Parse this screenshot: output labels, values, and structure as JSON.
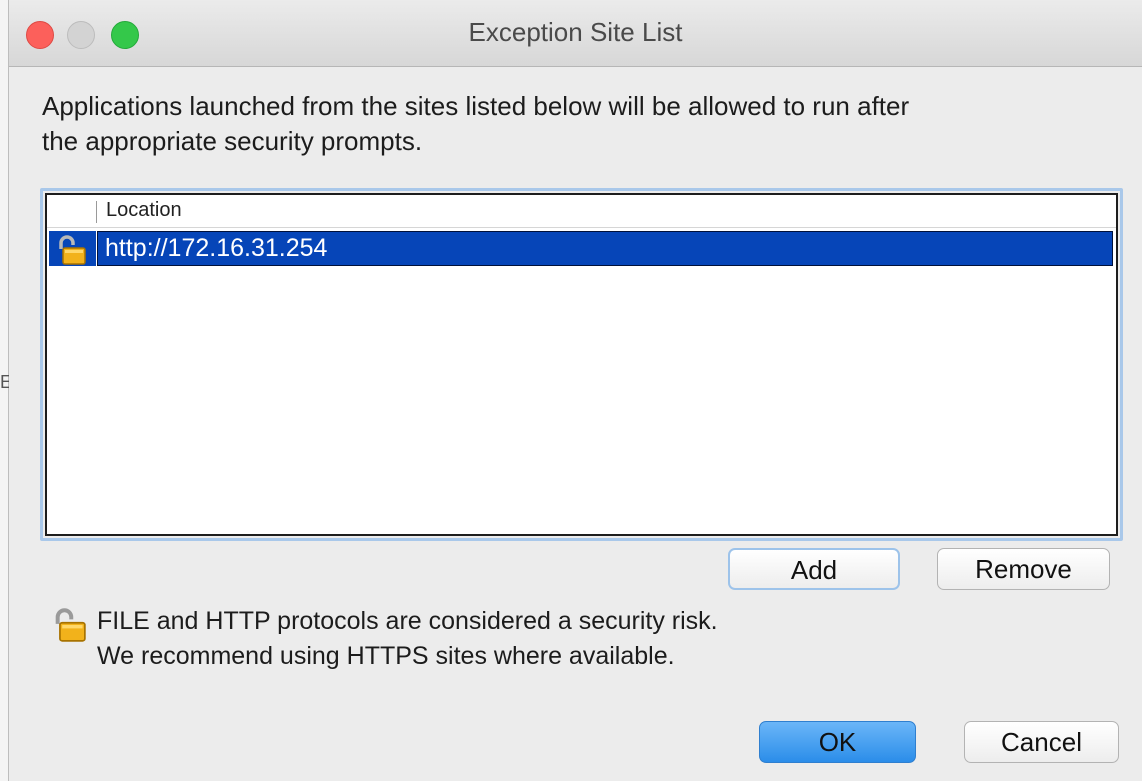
{
  "window": {
    "title": "Exception Site List"
  },
  "background": {
    "left_edge_mark": "E"
  },
  "description": {
    "line1": "Applications launched from the sites listed below will be allowed to run after",
    "line2": "the appropriate security prompts."
  },
  "site_list": {
    "column_header": "Location",
    "rows": [
      {
        "icon": "open-padlock-icon",
        "url": "http://172.16.31.254",
        "selected": true
      }
    ]
  },
  "list_buttons": {
    "add": "Add",
    "remove": "Remove"
  },
  "warning": {
    "icon": "open-padlock-icon",
    "line1": "FILE and HTTP protocols are considered a security risk.",
    "line2": "We recommend using HTTPS sites where available."
  },
  "dialog_buttons": {
    "ok": "OK",
    "cancel": "Cancel"
  },
  "colors": {
    "selection": "#0645b8",
    "ok_button": "#2b8de9",
    "traffic_close": "#fc605b",
    "traffic_max": "#34c84a"
  }
}
